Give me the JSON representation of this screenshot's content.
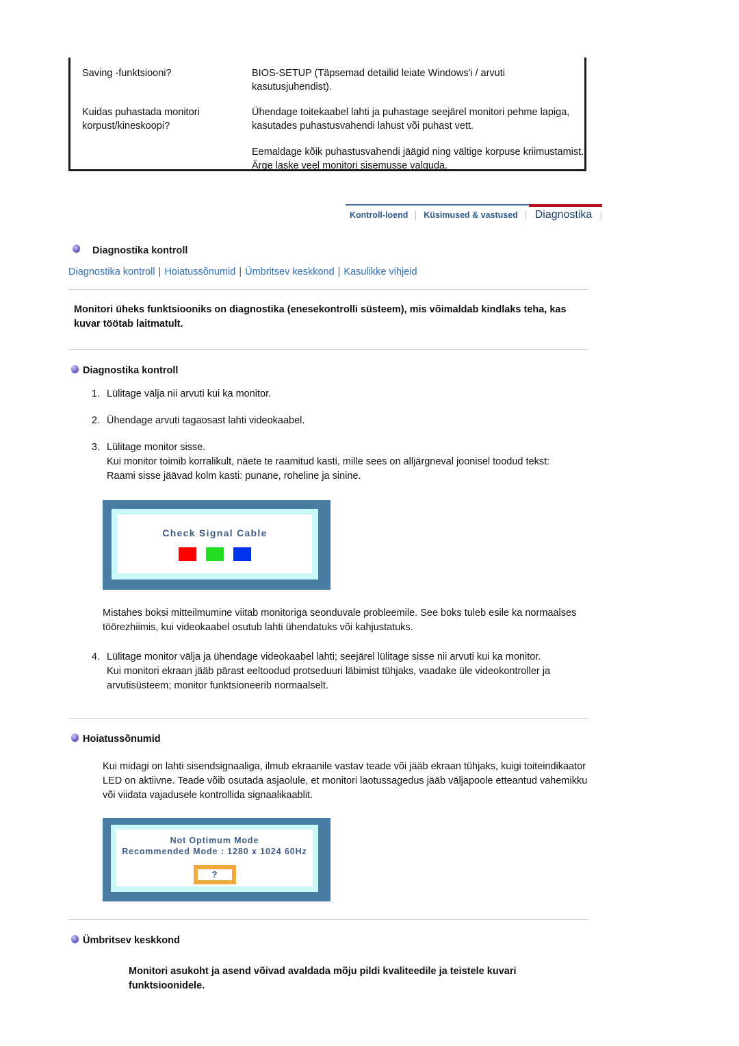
{
  "faq": {
    "rows": [
      {
        "question": "Saving -funktsiooni?",
        "answer_paragraphs": [
          "BIOS-SETUP (Täpsemad detailid leiate Windows'i / arvuti kasutusjuhendist)."
        ]
      },
      {
        "question": "Kuidas puhastada monitori korpust/kineskoopi?",
        "answer_paragraphs": [
          "Ühendage toitekaabel lahti ja puhastage seejärel monitori pehme lapiga, kasutades puhastusvahendi lahust või puhast vett.",
          "Eemaldage kõik puhastusvahendi jäägid ning vältige korpuse kriimustamist. Ärge laske veel monitori sisemusse valguda."
        ]
      }
    ]
  },
  "tabbar": {
    "tabs": [
      {
        "label": "Kontroll-loend",
        "active": false
      },
      {
        "label": "Küsimused & vastused",
        "active": false
      },
      {
        "label": "Diagnostika",
        "active": true
      }
    ],
    "separator": "│",
    "rule_color_left": "#4a6fa5",
    "rule_color_right": "#b5151b"
  },
  "page": {
    "title": "Diagnostika kontroll",
    "links": [
      "Diagnostika kontroll",
      "Hoiatussõnumid",
      "Ümbritsev keskkond",
      "Kasulikke vihjeid"
    ],
    "link_separator": "|",
    "lead": "Monitori üheks funktsiooniks on diagnostika (enesekontrolli süsteem), mis võimaldab kindlaks teha, kas kuvar töötab laitmatult."
  },
  "section_diagnostics": {
    "heading": "Diagnostika kontroll",
    "steps": [
      {
        "lines": [
          "Lülitage välja nii arvuti kui ka monitor."
        ]
      },
      {
        "lines": [
          "Ühendage arvuti tagaosast lahti videokaabel."
        ]
      },
      {
        "lines": [
          "Lülitage monitor sisse.",
          "Kui monitor toimib korralikult, näete te raamitud kasti, mille sees on alljärgneval joonisel toodud tekst:",
          "Raami sisse jäävad kolm kasti: punane, roheline ja sinine."
        ]
      },
      {
        "lines": [
          "Lülitage monitor välja ja ühendage videokaabel lahti; seejärel lülitage sisse nii arvuti kui ka monitor.",
          "Kui monitori ekraan jääb pärast eeltoodud protseduuri läbimist tühjaks, vaadake üle videokontroller ja arvutisüsteem; monitor funktsioneerib normaalselt."
        ]
      }
    ],
    "note": "Mistahes boksi mitteilmumine viitab monitoriga seonduvale probleemile. See boks tuleb esile ka normaalses töörezhiimis, kui videokaabel osutub lahti ühendatuks või kahjustatuks."
  },
  "osd_check_signal": {
    "title": "Check Signal Cable",
    "swatches": [
      {
        "name": "red-swatch",
        "color": "#ff0000"
      },
      {
        "name": "green-swatch",
        "color": "#22dd22"
      },
      {
        "name": "blue-swatch",
        "color": "#0033ee"
      }
    ],
    "bezel_color": "#4a7da3",
    "inner_color": "#caf8f8",
    "screen_color": "#ffffff",
    "text_color": "#3d5c85"
  },
  "section_warnings": {
    "heading": "Hoiatussõnumid",
    "body": "Kui midagi on lahti sisendsignaaliga, ilmub ekraanile vastav teade või jääb ekraan tühjaks, kuigi toiteindikaator LED on aktiivne. Teade võib osutada asjaolule, et monitori laotussagedus jääb väljapoole etteantud vahemikku või viidata vajadusele kontrollida signaalikaablit."
  },
  "osd_not_optimum": {
    "line1": "Not Optimum Mode",
    "line2": "Recommended Mode : 1280 x 1024  60Hz",
    "question_mark": "?",
    "qbox_border_color": "#f2a93b"
  },
  "section_environment": {
    "heading": "Ümbritsev keskkond",
    "body": "Monitori asukoht ja asend võivad avaldada mõju pildi kvaliteedile ja teistele kuvari funktsioonidele."
  }
}
